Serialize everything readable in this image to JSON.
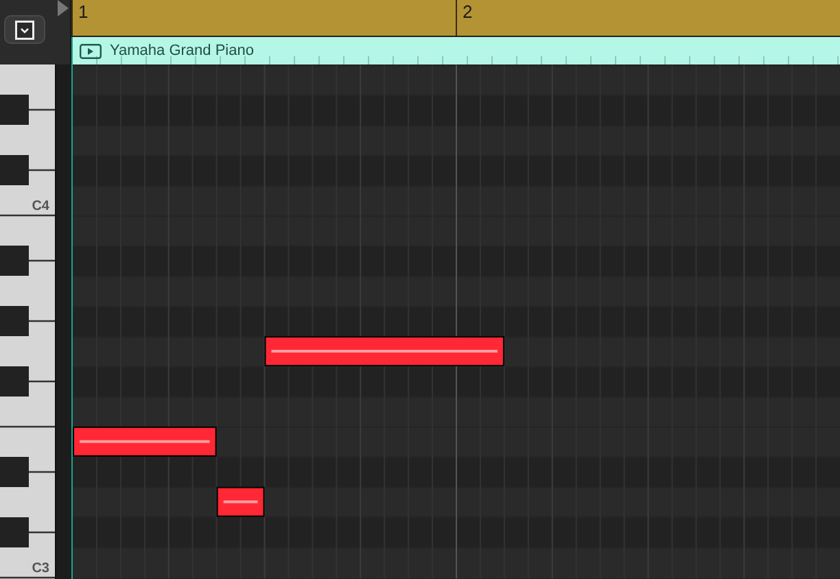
{
  "ruler": {
    "bars": [
      {
        "label": "1"
      },
      {
        "label": "2"
      }
    ]
  },
  "region": {
    "name": "Yamaha Grand Piano"
  },
  "keyboard": {
    "octave_labels": [
      "C4",
      "C3"
    ]
  }
}
